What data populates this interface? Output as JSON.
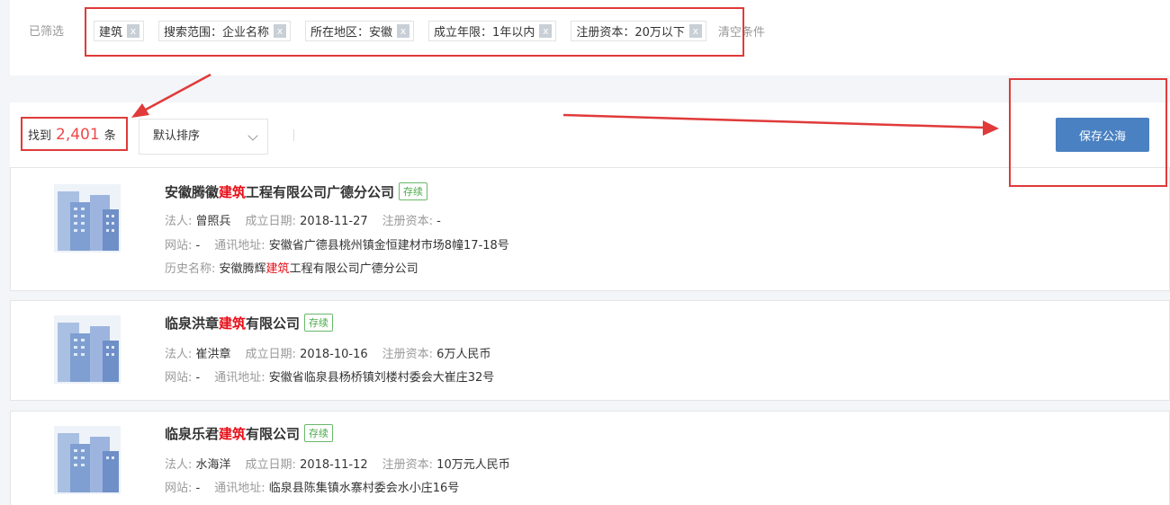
{
  "filter": {
    "label": "已筛选",
    "chips": [
      {
        "text": "建筑",
        "x": "x"
      },
      {
        "text": "搜索范围：企业名称",
        "x": "x"
      },
      {
        "text": "所在地区：安徽",
        "x": "x"
      },
      {
        "text": "成立年限：1年以内",
        "x": "x"
      },
      {
        "text": "注册资本：20万以下",
        "x": "x"
      }
    ],
    "clear": "清空条件"
  },
  "toolbar": {
    "found_prefix": "找到",
    "count": "2,401",
    "found_suffix": "条",
    "sort_value": "默认排序",
    "save_label": "保存公海"
  },
  "results": [
    {
      "name_pre": "安徽腾徽",
      "name_hl": "建筑",
      "name_post": "工程有限公司广德分公司",
      "status": "存续",
      "legal_k": "法人:",
      "legal_v": "曾照兵",
      "date_k": "成立日期:",
      "date_v": "2018-11-27",
      "cap_k": "注册资本:",
      "cap_v": "-",
      "web_k": "网站:",
      "web_v": "-",
      "addr_k": "通讯地址:",
      "addr_v": "安徽省广德县桃州镇金恒建材市场8幢17-18号",
      "hist_k": "历史名称:",
      "hist_pre": "安徽腾辉",
      "hist_hl": "建筑",
      "hist_post": "工程有限公司广德分公司"
    },
    {
      "name_pre": "临泉洪章",
      "name_hl": "建筑",
      "name_post": "有限公司",
      "status": "存续",
      "legal_k": "法人:",
      "legal_v": "崔洪章",
      "date_k": "成立日期:",
      "date_v": "2018-10-16",
      "cap_k": "注册资本:",
      "cap_v": "6万人民币",
      "web_k": "网站:",
      "web_v": "-",
      "addr_k": "通讯地址:",
      "addr_v": "安徽省临泉县杨桥镇刘楼村委会大崔庄32号"
    },
    {
      "name_pre": "临泉乐君",
      "name_hl": "建筑",
      "name_post": "有限公司",
      "status": "存续",
      "legal_k": "法人:",
      "legal_v": "水海洋",
      "date_k": "成立日期:",
      "date_v": "2018-11-12",
      "cap_k": "注册资本:",
      "cap_v": "10万元人民币",
      "web_k": "网站:",
      "web_v": "-",
      "addr_k": "通讯地址:",
      "addr_v": "临泉县陈集镇水寨村委会水小庄16号"
    }
  ],
  "colors": {
    "highlight": "#e8101a",
    "accent": "#4a81c2",
    "annotation": "#e03a3a",
    "status": "#4aaa4a"
  }
}
